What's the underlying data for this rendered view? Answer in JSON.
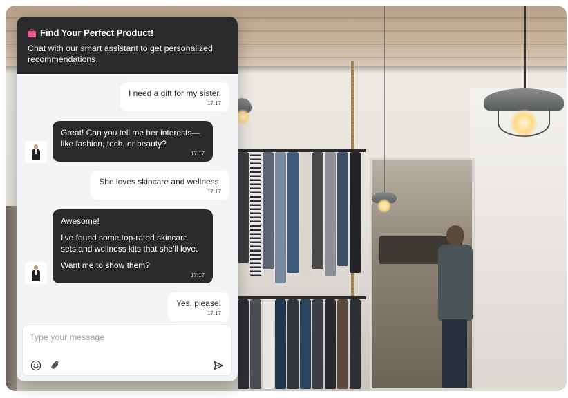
{
  "header": {
    "icon": "shopping-bag-icon",
    "title": "Find Your Perfect Product!",
    "subtitle": "Chat with our smart assistant to get personalized recommendations."
  },
  "messages": [
    {
      "sender": "user",
      "text": "I need a gift for my sister.",
      "time": "17:17"
    },
    {
      "sender": "bot",
      "text": "Great! Can you tell me her interests—like fashion, tech, or beauty?",
      "time": "17:17"
    },
    {
      "sender": "user",
      "text": "She loves skincare and wellness.",
      "time": "17:17"
    },
    {
      "sender": "bot",
      "paragraphs": [
        "Awesome!",
        "I've found some top-rated skincare sets and wellness kits that she'll love.",
        "Want me to show them?"
      ],
      "time": "17:17"
    },
    {
      "sender": "user",
      "text": "Yes, please!",
      "time": "17:17"
    }
  ],
  "composer": {
    "placeholder": "Type your message",
    "value": "",
    "icons": [
      "emoji-icon",
      "attachment-icon",
      "send-icon"
    ]
  },
  "colors": {
    "header_bg": "#2a2a2c",
    "bot_bubble": "#2a2a2c",
    "user_bubble": "#ffffff",
    "chat_bg": "#f3f4f5",
    "accent_bag": "#e85a8f"
  }
}
